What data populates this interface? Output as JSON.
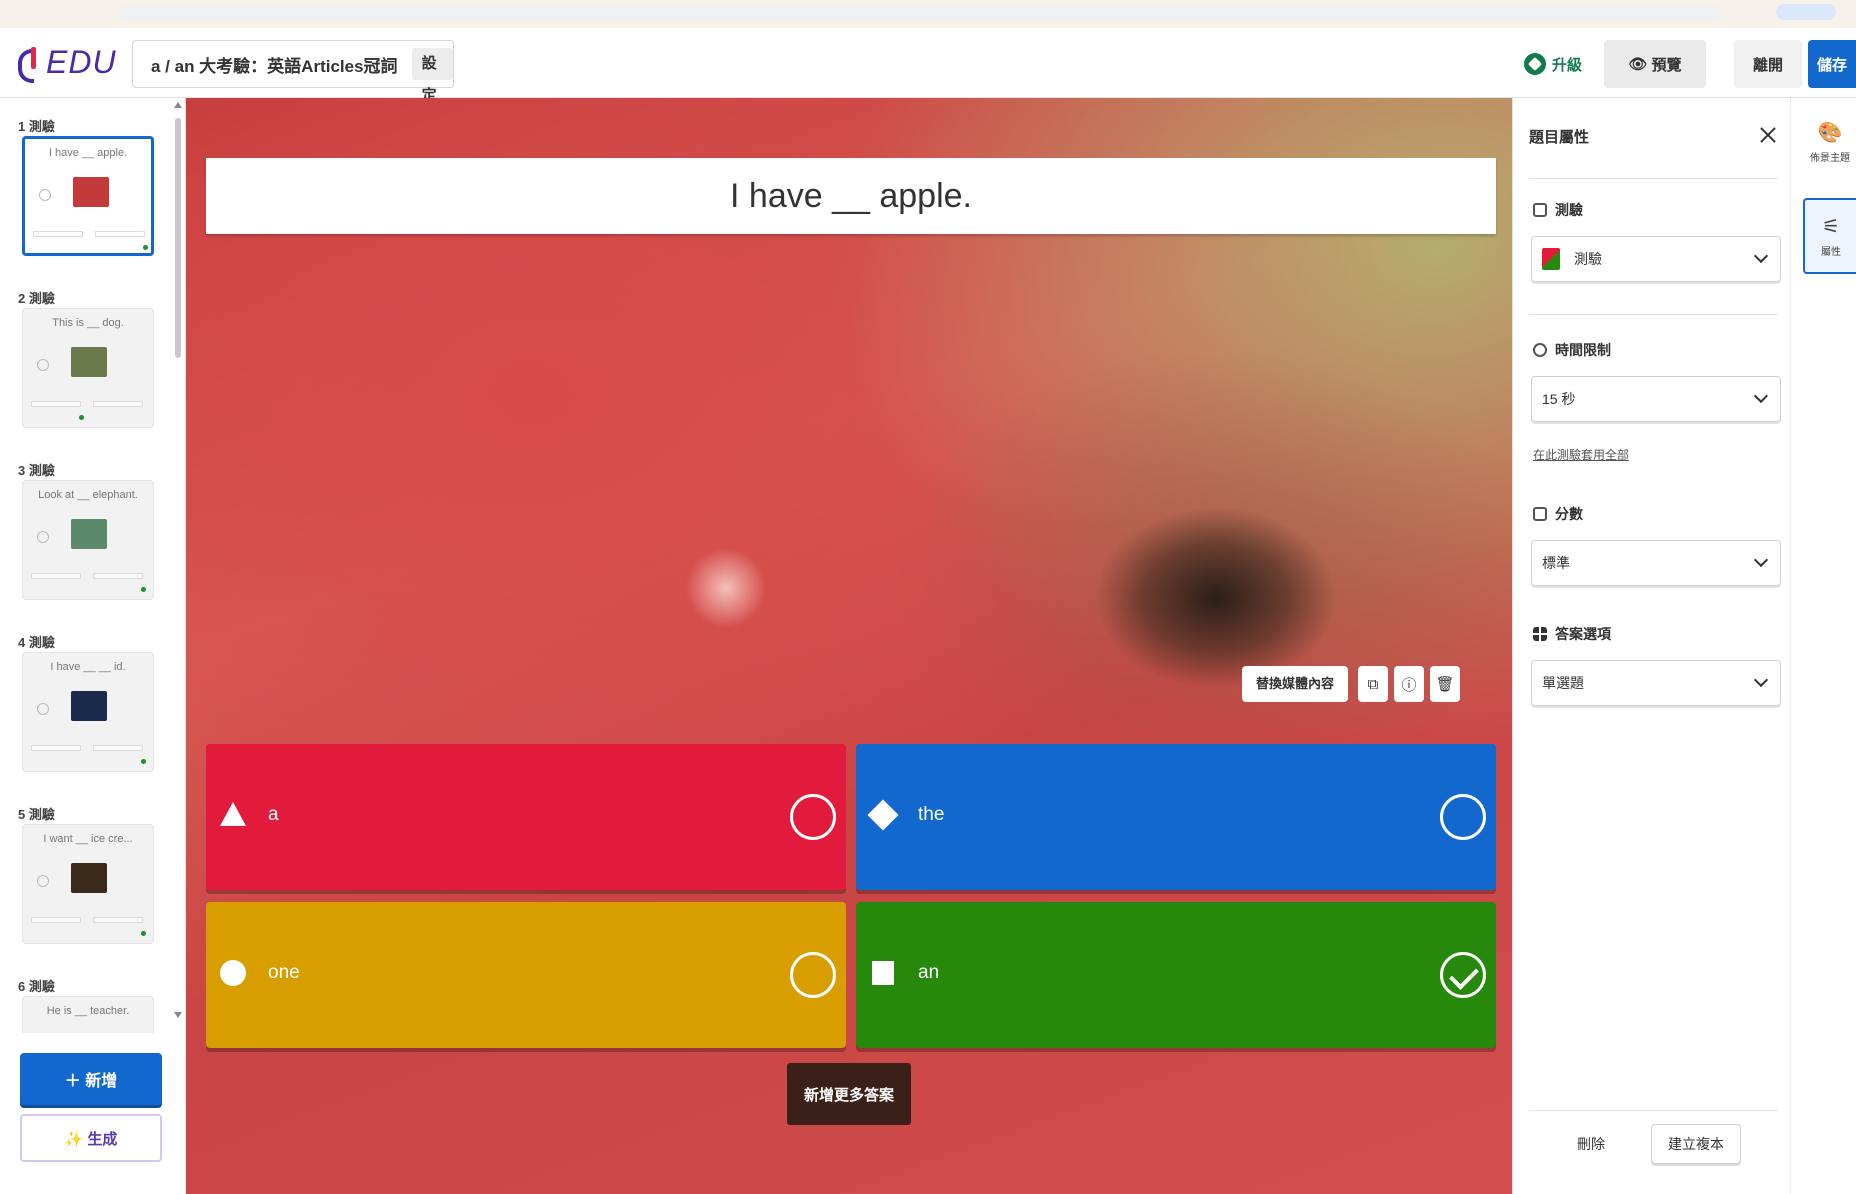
{
  "header": {
    "logo": "EDU",
    "quiz_title": "a / an 大考驗：英語Articles冠詞",
    "settings_label": "設定",
    "upgrade_label": "升級",
    "preview_label": "預覽",
    "exit_label": "離開",
    "save_label": "儲存"
  },
  "sidebar": {
    "slides": [
      {
        "label": "1 測驗",
        "question": "I have __ apple.",
        "thumb_color": "#c43a3a"
      },
      {
        "label": "2 測驗",
        "question": "This is __ dog.",
        "thumb_color": "#6b7a4a"
      },
      {
        "label": "3 測驗",
        "question": "Look at __ elephant.",
        "thumb_color": "#5a8a6a"
      },
      {
        "label": "4 測驗",
        "question": "I have __ __ id.",
        "thumb_color": "#1a2a4a"
      },
      {
        "label": "5 測驗",
        "question": "I want __ ice cre...",
        "thumb_color": "#3a2a1a"
      },
      {
        "label": "6 測驗",
        "question": "He is __ teacher.",
        "thumb_color": "#8a8a8a"
      }
    ],
    "add_label": "＋ 新增",
    "generate_label": "✨ 生成"
  },
  "canvas": {
    "question": "I have __ apple.",
    "replace_media_label": "替換媒體內容",
    "add_more_label": "新增更多答案",
    "answers": [
      {
        "text": "a",
        "shape": "triangle",
        "color": "#e21b3c",
        "correct": false
      },
      {
        "text": "the",
        "shape": "diamond",
        "color": "#1368ce",
        "correct": false
      },
      {
        "text": "one",
        "shape": "circle",
        "color": "#d89e00",
        "correct": false
      },
      {
        "text": "an",
        "shape": "square",
        "color": "#26890c",
        "correct": true
      }
    ]
  },
  "panel": {
    "title": "題目屬性",
    "type_label": "測驗",
    "type_value": "測驗",
    "time_label": "時間限制",
    "time_value": "15 秒",
    "time_link": "在此測驗套用全部",
    "points_label": "分數",
    "points_value": "標準",
    "answer_options_label": "答案選項",
    "answer_options_value": "單選題",
    "delete_label": "刪除",
    "duplicate_label": "建立複本"
  },
  "rail": {
    "themes_label": "佈景主題",
    "settings_label": "屬性"
  },
  "colors": {
    "brand": "#4b2aa8",
    "primary": "#1368ce",
    "red": "#e21b3c",
    "blue": "#1368ce",
    "yellow": "#d89e00",
    "green": "#26890c"
  }
}
